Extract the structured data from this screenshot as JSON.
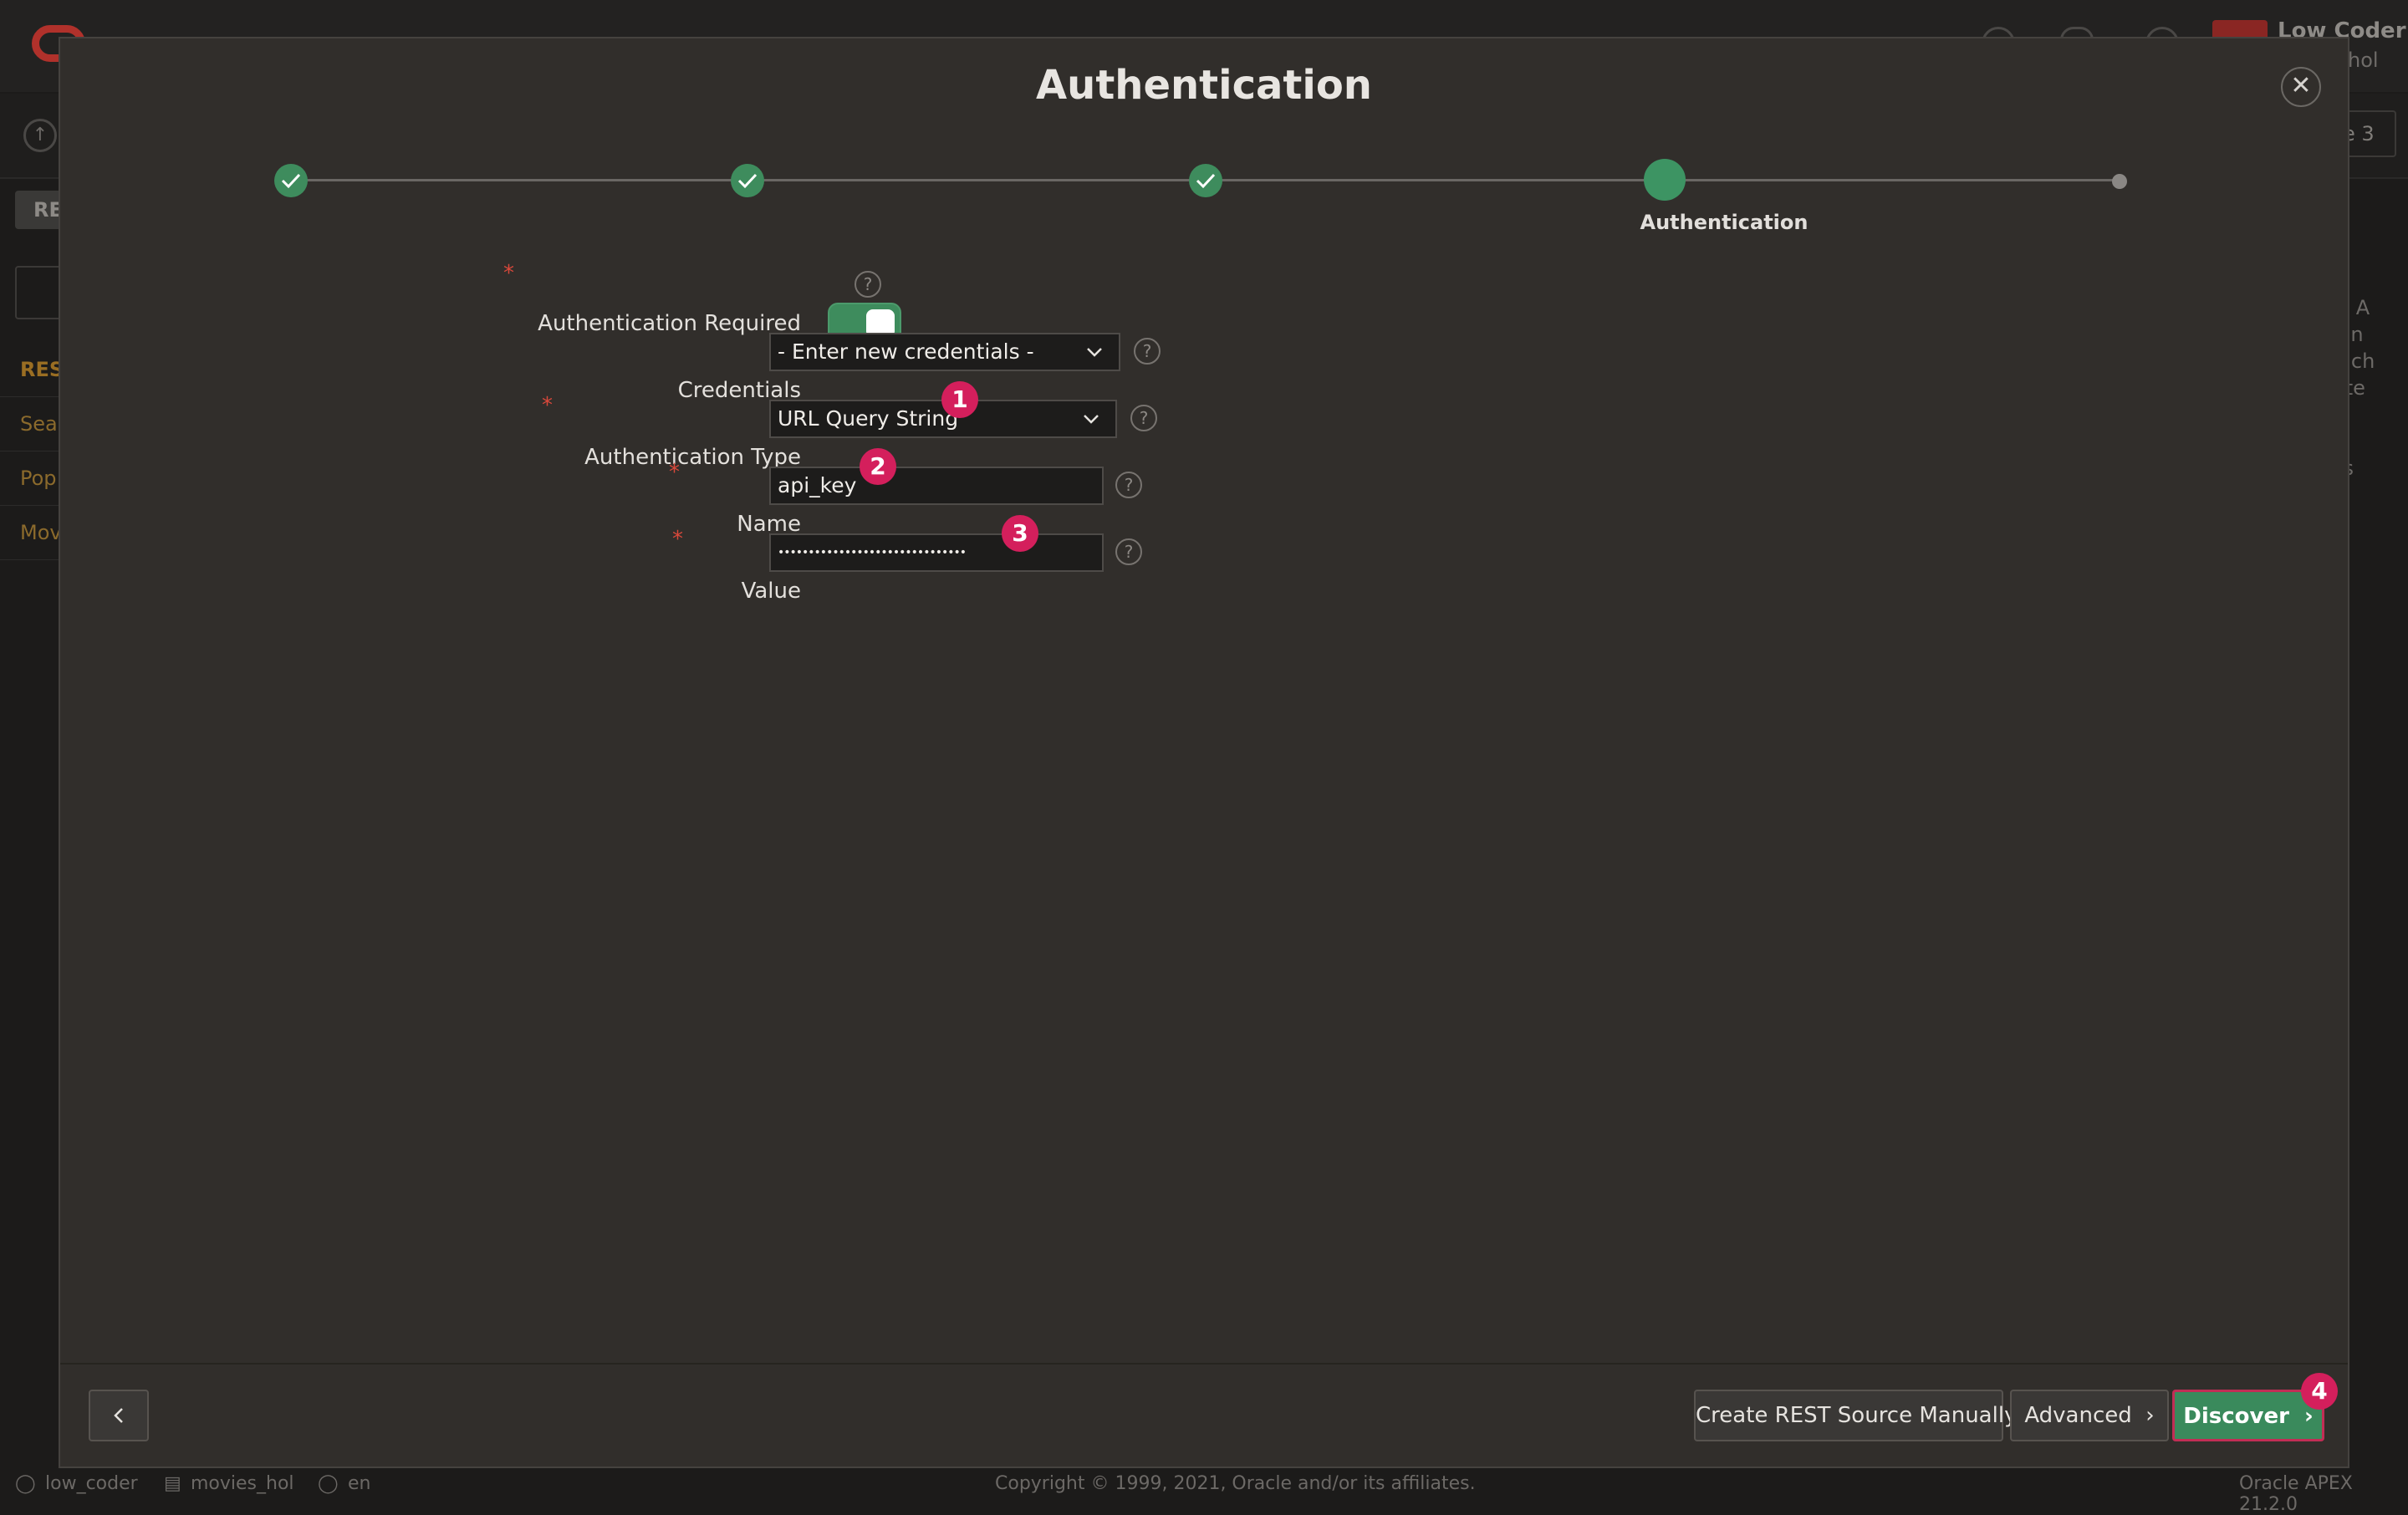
{
  "background": {
    "user_name": "Low Coder",
    "user_sub": "_hol",
    "right_button": "e 3",
    "tab_label": "RE",
    "left_list": [
      "REST",
      "Sear",
      "Pop",
      "Mov"
    ],
    "right_text": [
      "s. A",
      "ain",
      "hich",
      "ete",
      "",
      "",
      "ss"
    ],
    "footer_user": "low_coder",
    "footer_schema": "movies_hol",
    "footer_lang": "en",
    "footer_copyright": "Copyright © 1999, 2021, Oracle and/or its affiliates.",
    "footer_version": "Oracle APEX 21.2.0"
  },
  "dialog": {
    "title": "Authentication",
    "close_icon": "close-icon",
    "progress": {
      "steps_completed": 3,
      "total_steps": 5,
      "current_step_label": "Authentication"
    },
    "form": {
      "auth_required_label": "Authentication Required",
      "auth_required_value": "on",
      "credentials_label": "Credentials",
      "credentials_value": "- Enter new credentials -",
      "auth_type_label": "Authentication Type",
      "auth_type_value": "URL Query String",
      "name_label": "Name",
      "name_value": "api_key",
      "value_label": "Value",
      "value_value": "•••••••••••••••••••••••••••••••"
    },
    "badges": [
      "1",
      "2",
      "3",
      "4"
    ],
    "footer": {
      "back_icon": "chevron-left-icon",
      "create_manual_label": "Create REST Source Manually",
      "advanced_label": "Advanced",
      "discover_label": "Discover"
    }
  },
  "colors": {
    "accent_green": "#3e8c5d",
    "required_red": "#d9483b",
    "badge_pink": "#d41f5c",
    "dialog_bg": "#312e2b"
  }
}
